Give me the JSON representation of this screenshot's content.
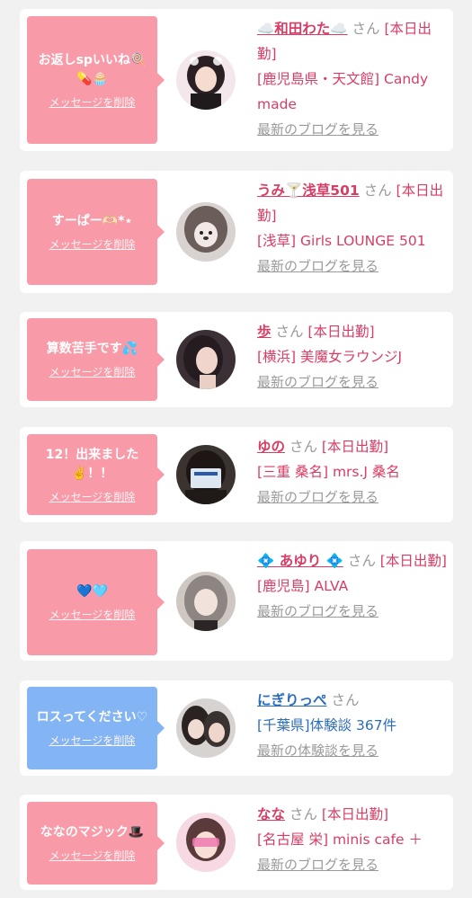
{
  "cards": [
    {
      "message": "お返しspいいね🍭💊🧁",
      "delete_label": "メッセージを削除",
      "name": "☁️和田わた☁️",
      "san": "さん",
      "status": "[本日出勤]",
      "shop": "[鹿児島県・天文館] Candy made",
      "link": "最新のブログを見る"
    },
    {
      "message": "すーぱー🫶🏻*⋆",
      "delete_label": "メッセージを削除",
      "name": "うみ🍸浅草501",
      "san": "さん",
      "status": "[本日出勤]",
      "shop": "[浅草] Girls LOUNGE 501",
      "link": "最新のブログを見る"
    },
    {
      "message": "算数苦手です💦",
      "delete_label": "メッセージを削除",
      "name": "歩",
      "san": "さん",
      "status": "[本日出勤]",
      "shop": "[横浜] 美魔女ラウンジJ",
      "link": "最新のブログを見る"
    },
    {
      "message": "12！出来ました✌️！！",
      "delete_label": "メッセージを削除",
      "name": "ゆの",
      "san": "さん",
      "status": "[本日出勤]",
      "shop": "[三重 桑名] mrs.J 桑名",
      "link": "最新のブログを見る"
    },
    {
      "message": "💙🩵",
      "delete_label": "メッセージを削除",
      "name": "💠 あゆり 💠",
      "san": "さん",
      "status": "[本日出勤]",
      "shop": "[鹿児島] ALVA",
      "link": "最新のブログを見る"
    },
    {
      "message": "ロスってください♡",
      "delete_label": "メッセージを削除",
      "name": "にぎりっぺ",
      "san": "さん",
      "status": "",
      "shop": "[千葉県]体験談 367件",
      "link": "最新の体験談を見る"
    },
    {
      "message": "ななのマジック🎩",
      "delete_label": "メッセージを削除",
      "name": "なな",
      "san": "さん",
      "status": "[本日出勤]",
      "shop": "[名古屋 栄] minis cafe ＋",
      "link": "最新のブログを見る"
    }
  ]
}
